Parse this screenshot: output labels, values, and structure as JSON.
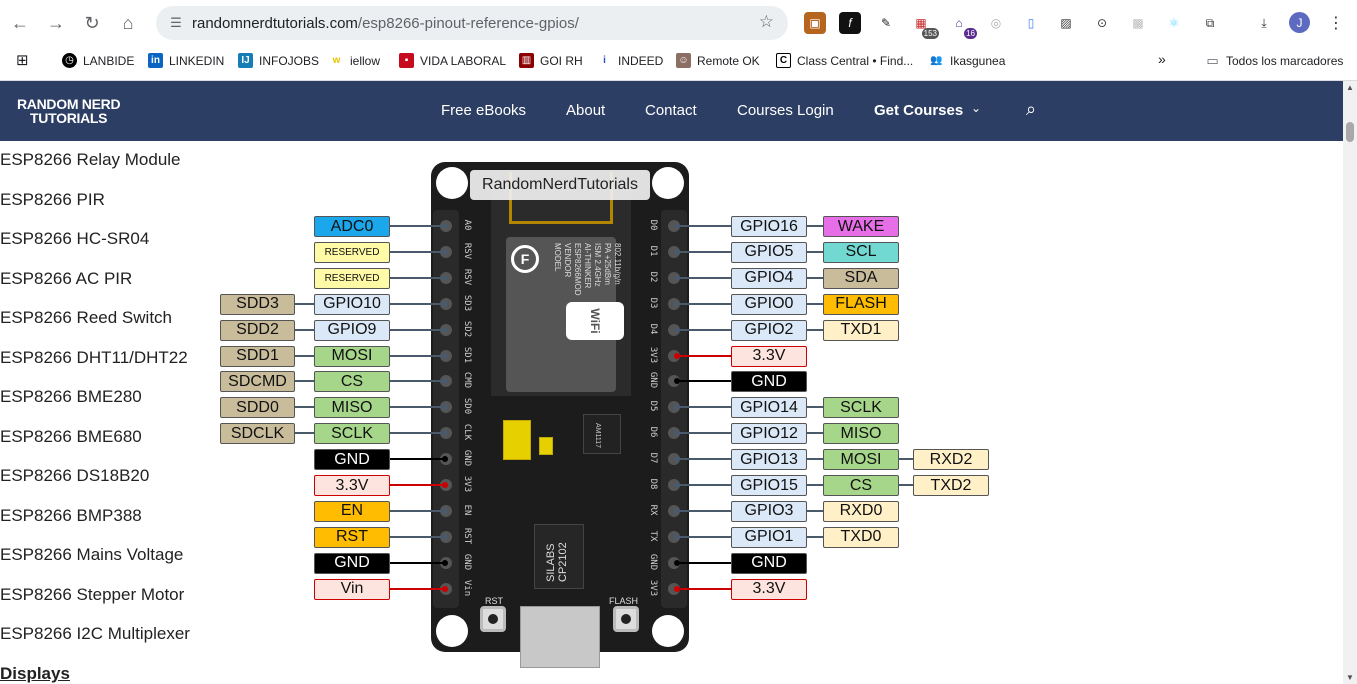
{
  "browser": {
    "url_domain": "randomnerdtutorials.com",
    "url_path": "/esp8266-pinout-reference-gpios/",
    "profile_initial": "J",
    "ext_badge_1": "153",
    "ext_badge_2": "16",
    "bookmarks": [
      "LANBIDE",
      "LINKEDIN",
      "INFOJOBS",
      "iellow",
      "VIDA LABORAL",
      "GOI RH",
      "INDEED",
      "Remote OK",
      "Class Central • Find...",
      "Ikasgunea"
    ],
    "all_bookmarks": "Todos los marcadores"
  },
  "site": {
    "logo_line1": "RANDOM NERD",
    "logo_line2": "TUTORIALS",
    "menu": [
      "Free eBooks",
      "About",
      "Contact",
      "Courses Login",
      "Get Courses"
    ]
  },
  "sidebar": {
    "links": [
      "ESP8266 Relay Module",
      "ESP8266 PIR",
      "ESP8266 HC-SR04",
      "ESP8266 AC PIR",
      "ESP8266 Reed Switch",
      "ESP8266 DHT11/DHT22",
      "ESP8266 BME280",
      "ESP8266 BME680",
      "ESP8266 DS18B20",
      "ESP8266 BMP388",
      "ESP8266 Mains Voltage",
      "ESP8266 Stepper Motor",
      "ESP8266 I2C Multiplexer"
    ],
    "heading": "Displays"
  },
  "diagram": {
    "title": "RandomNerdTutorials",
    "module_text": [
      "MODEL",
      "VENDOR",
      "ESP8266MOD",
      "AI-THINKER",
      "ISM 2.4GHz",
      "PA +25dBm",
      "802.11b/g/n"
    ],
    "wifi": "WiFi",
    "chip_text": [
      "SILABS",
      "CP2102"
    ],
    "regulator": "AM1117",
    "rst": "RST",
    "flash": "FLASH",
    "left_silk": [
      "A0",
      "RSV",
      "RSV",
      "SD3",
      "SD2",
      "SD1",
      "CMD",
      "SD0",
      "CLK",
      "GND",
      "3V3",
      "EN",
      "RST",
      "GND",
      "Vin"
    ],
    "right_silk": [
      "D0",
      "D1",
      "D2",
      "D3",
      "D4",
      "3V3",
      "GND",
      "D5",
      "D6",
      "D7",
      "D8",
      "RX",
      "TX",
      "GND",
      "3V3"
    ],
    "left_inner": [
      "ADC0",
      "RESERVED",
      "RESERVED",
      "GPIO10",
      "GPIO9",
      "MOSI",
      "CS",
      "MISO",
      "SCLK",
      "GND",
      "3.3V",
      "EN",
      "RST",
      "GND",
      "Vin"
    ],
    "left_outer": [
      "",
      "",
      "",
      "SDD3",
      "SDD2",
      "SDD1",
      "SDCMD",
      "SDD0",
      "SDCLK",
      "",
      "",
      "",
      "",
      "",
      ""
    ],
    "right_inner": [
      "GPIO16",
      "GPIO5",
      "GPIO4",
      "GPIO0",
      "GPIO2",
      "3.3V",
      "GND",
      "GPIO14",
      "GPIO12",
      "GPIO13",
      "GPIO15",
      "GPIO3",
      "GPIO1",
      "GND",
      "3.3V"
    ],
    "right_mid": [
      "WAKE",
      "SCL",
      "SDA",
      "FLASH",
      "TXD1",
      "",
      "",
      "SCLK",
      "MISO",
      "MOSI",
      "CS",
      "RXD0",
      "TXD0",
      "",
      ""
    ],
    "right_outer": [
      "",
      "",
      "",
      "",
      "",
      "",
      "",
      "",
      "",
      "RXD2",
      "TXD2",
      "",
      "",
      "",
      ""
    ]
  },
  "colors": {
    "header_bg": "#2c3e63",
    "adc": "#1aa7ec",
    "reserved": "#fffaa6",
    "gpio": "#dbe8f7",
    "sd": "#c9bc9b",
    "spi": "#a6d68a",
    "gnd": "#000000",
    "power": "#fde4de",
    "control": "#ffbc00",
    "wake": "#e66ee6",
    "i2c": "#72d9d2",
    "uart": "#fff0c8"
  }
}
